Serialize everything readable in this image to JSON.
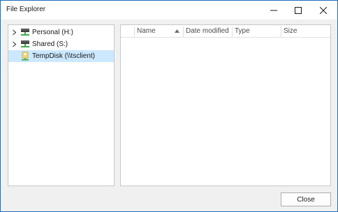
{
  "window": {
    "title": "File Explorer",
    "controls": {
      "minimize_icon": "minimize-icon",
      "maximize_icon": "maximize-icon",
      "close_icon": "close-icon"
    }
  },
  "tree": {
    "items": [
      {
        "label": "Personal (H:)",
        "icon": "network-drive-icon",
        "expandable": true,
        "selected": false
      },
      {
        "label": "Shared (S:)",
        "icon": "network-drive-icon",
        "expandable": true,
        "selected": false
      },
      {
        "label": "TempDisk (\\\\tsclient)",
        "icon": "removable-disk-icon",
        "expandable": false,
        "selected": true
      }
    ]
  },
  "file_list": {
    "columns": [
      {
        "label": "Name",
        "sorted": "ascending"
      },
      {
        "label": "Date modified"
      },
      {
        "label": "Type"
      },
      {
        "label": "Size"
      }
    ],
    "rows": []
  },
  "footer": {
    "close_label": "Close"
  },
  "colors": {
    "accent_border": "#1f6fb8",
    "selection": "#cce8ff",
    "drive_green": "#3fae49"
  }
}
